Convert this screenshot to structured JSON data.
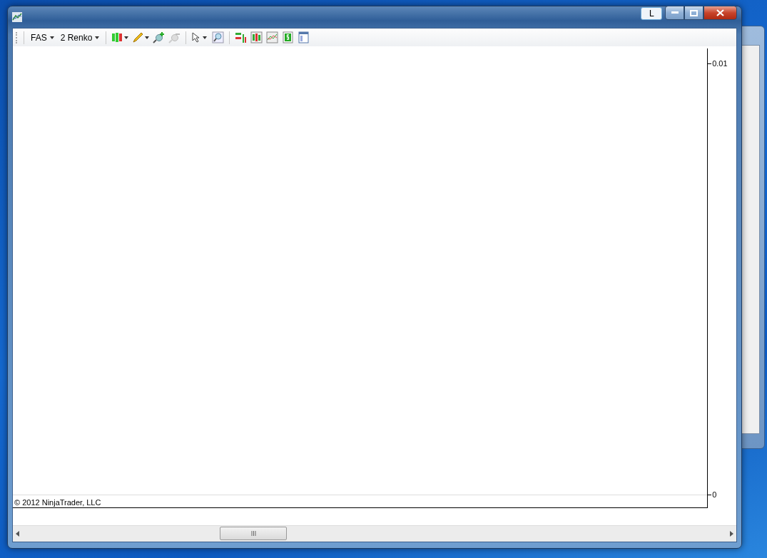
{
  "window": {
    "caption_button": "L"
  },
  "toolbar": {
    "instrument": "FAS",
    "period": "2 Renko"
  },
  "chart": {
    "price_axis": [
      {
        "label": "0.01"
      },
      {
        "label": "0"
      }
    ],
    "copyright": "© 2012 NinjaTrader, LLC"
  }
}
